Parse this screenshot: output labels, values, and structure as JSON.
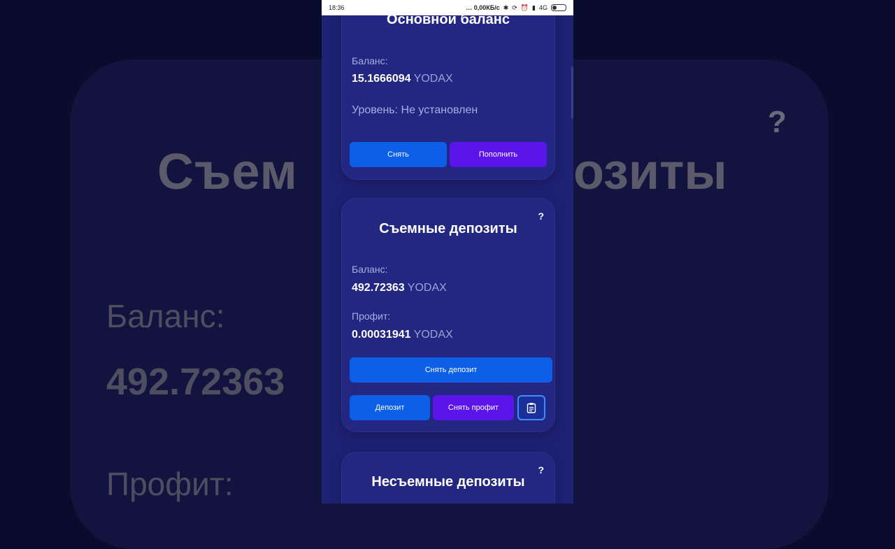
{
  "background": {
    "title_left": "Съем",
    "title_right": "озиты",
    "label_balance": "Баланс:",
    "value_balance": "492.72363",
    "label_profit": "Профит:",
    "help": "?"
  },
  "statusbar": {
    "time": "18:36",
    "speed": "… 0,00КБ/с",
    "network": "4G"
  },
  "main_balance": {
    "title": "Основной баланс",
    "balance_label": "Баланс:",
    "balance_value": "15.1666094",
    "currency": "YODAX",
    "level": "Уровень: Не установлен",
    "withdraw_label": "Снять",
    "topup_label": "Пополнить"
  },
  "removable_deposits": {
    "title": "Съемные депозиты",
    "help": "?",
    "balance_label": "Баланс:",
    "balance_value": "492.72363",
    "currency": "YODAX",
    "profit_label": "Профит:",
    "profit_value": "0.00031941",
    "withdraw_deposit_label": "Снять депозит",
    "deposit_label": "Депозит",
    "withdraw_profit_label": "Снять профит"
  },
  "fixed_deposits": {
    "title": "Несъемные депозиты",
    "help": "?"
  },
  "colors": {
    "phone_bg": "#1f2175",
    "card_bg": "#232782",
    "button_blue": "#0d5fe8",
    "button_purple": "#5b14ea"
  }
}
